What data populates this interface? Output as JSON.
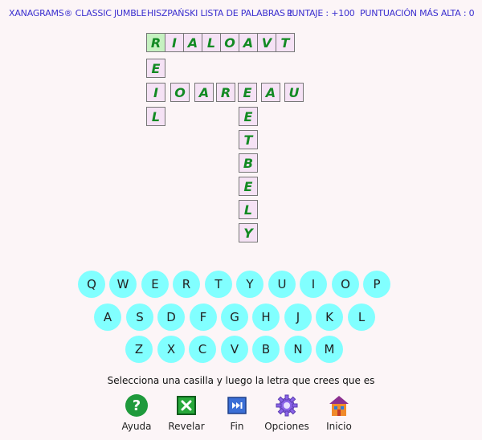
{
  "header": {
    "title": "XANAGRAMS® CLASSIC JUMBLE",
    "list": "HISZPAŃSKI LISTA DE PALABRAS 1",
    "score": "PUNTAJE : +100",
    "high_score": "PUNTUACIÓN MÁS ALTA : 0"
  },
  "grid": {
    "row1": [
      "R",
      "I",
      "A",
      "L",
      "O",
      "A",
      "V",
      "T"
    ],
    "col1": [
      "E",
      "I",
      "L"
    ],
    "row3": [
      "O",
      "A",
      "R",
      "E",
      "A",
      "U"
    ],
    "col5": [
      "E",
      "T",
      "B",
      "E",
      "L",
      "Y"
    ],
    "selected_color": "#c6f1c1",
    "letter_color": "#138a24"
  },
  "keyboard": {
    "row1": [
      "Q",
      "W",
      "E",
      "R",
      "T",
      "Y",
      "U",
      "I",
      "O",
      "P"
    ],
    "row2": [
      "A",
      "S",
      "D",
      "F",
      "G",
      "H",
      "J",
      "K",
      "L"
    ],
    "row3": [
      "Z",
      "X",
      "C",
      "V",
      "B",
      "N",
      "M"
    ],
    "key_color": "#81ffff"
  },
  "instruction": "Selecciona una casilla y luego la letra que crees que es",
  "toolbar": {
    "help": "Ayuda",
    "reveal": "Revelar",
    "end": "Fin",
    "options": "Opciones",
    "home": "Inicio"
  },
  "icons": {
    "help": "question-circle-icon",
    "reveal": "x-box-icon",
    "end": "skip-forward-icon",
    "options": "gear-icon",
    "home": "house-icon"
  }
}
